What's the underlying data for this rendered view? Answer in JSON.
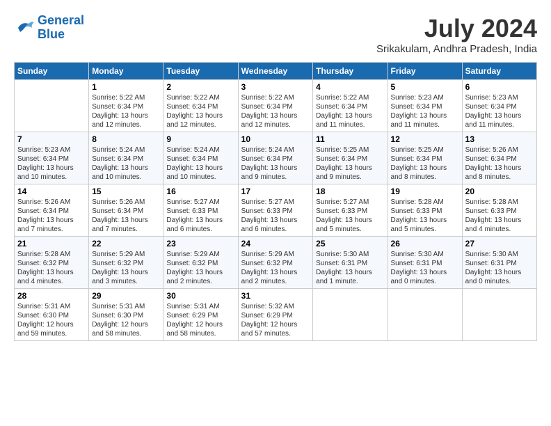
{
  "header": {
    "logo_line1": "General",
    "logo_line2": "Blue",
    "month_year": "July 2024",
    "location": "Srikakulam, Andhra Pradesh, India"
  },
  "weekdays": [
    "Sunday",
    "Monday",
    "Tuesday",
    "Wednesday",
    "Thursday",
    "Friday",
    "Saturday"
  ],
  "weeks": [
    [
      {
        "day": "",
        "info": ""
      },
      {
        "day": "1",
        "info": "Sunrise: 5:22 AM\nSunset: 6:34 PM\nDaylight: 13 hours\nand 12 minutes."
      },
      {
        "day": "2",
        "info": "Sunrise: 5:22 AM\nSunset: 6:34 PM\nDaylight: 13 hours\nand 12 minutes."
      },
      {
        "day": "3",
        "info": "Sunrise: 5:22 AM\nSunset: 6:34 PM\nDaylight: 13 hours\nand 12 minutes."
      },
      {
        "day": "4",
        "info": "Sunrise: 5:22 AM\nSunset: 6:34 PM\nDaylight: 13 hours\nand 11 minutes."
      },
      {
        "day": "5",
        "info": "Sunrise: 5:23 AM\nSunset: 6:34 PM\nDaylight: 13 hours\nand 11 minutes."
      },
      {
        "day": "6",
        "info": "Sunrise: 5:23 AM\nSunset: 6:34 PM\nDaylight: 13 hours\nand 11 minutes."
      }
    ],
    [
      {
        "day": "7",
        "info": "Sunrise: 5:23 AM\nSunset: 6:34 PM\nDaylight: 13 hours\nand 10 minutes."
      },
      {
        "day": "8",
        "info": "Sunrise: 5:24 AM\nSunset: 6:34 PM\nDaylight: 13 hours\nand 10 minutes."
      },
      {
        "day": "9",
        "info": "Sunrise: 5:24 AM\nSunset: 6:34 PM\nDaylight: 13 hours\nand 10 minutes."
      },
      {
        "day": "10",
        "info": "Sunrise: 5:24 AM\nSunset: 6:34 PM\nDaylight: 13 hours\nand 9 minutes."
      },
      {
        "day": "11",
        "info": "Sunrise: 5:25 AM\nSunset: 6:34 PM\nDaylight: 13 hours\nand 9 minutes."
      },
      {
        "day": "12",
        "info": "Sunrise: 5:25 AM\nSunset: 6:34 PM\nDaylight: 13 hours\nand 8 minutes."
      },
      {
        "day": "13",
        "info": "Sunrise: 5:26 AM\nSunset: 6:34 PM\nDaylight: 13 hours\nand 8 minutes."
      }
    ],
    [
      {
        "day": "14",
        "info": "Sunrise: 5:26 AM\nSunset: 6:34 PM\nDaylight: 13 hours\nand 7 minutes."
      },
      {
        "day": "15",
        "info": "Sunrise: 5:26 AM\nSunset: 6:34 PM\nDaylight: 13 hours\nand 7 minutes."
      },
      {
        "day": "16",
        "info": "Sunrise: 5:27 AM\nSunset: 6:33 PM\nDaylight: 13 hours\nand 6 minutes."
      },
      {
        "day": "17",
        "info": "Sunrise: 5:27 AM\nSunset: 6:33 PM\nDaylight: 13 hours\nand 6 minutes."
      },
      {
        "day": "18",
        "info": "Sunrise: 5:27 AM\nSunset: 6:33 PM\nDaylight: 13 hours\nand 5 minutes."
      },
      {
        "day": "19",
        "info": "Sunrise: 5:28 AM\nSunset: 6:33 PM\nDaylight: 13 hours\nand 5 minutes."
      },
      {
        "day": "20",
        "info": "Sunrise: 5:28 AM\nSunset: 6:33 PM\nDaylight: 13 hours\nand 4 minutes."
      }
    ],
    [
      {
        "day": "21",
        "info": "Sunrise: 5:28 AM\nSunset: 6:32 PM\nDaylight: 13 hours\nand 4 minutes."
      },
      {
        "day": "22",
        "info": "Sunrise: 5:29 AM\nSunset: 6:32 PM\nDaylight: 13 hours\nand 3 minutes."
      },
      {
        "day": "23",
        "info": "Sunrise: 5:29 AM\nSunset: 6:32 PM\nDaylight: 13 hours\nand 2 minutes."
      },
      {
        "day": "24",
        "info": "Sunrise: 5:29 AM\nSunset: 6:32 PM\nDaylight: 13 hours\nand 2 minutes."
      },
      {
        "day": "25",
        "info": "Sunrise: 5:30 AM\nSunset: 6:31 PM\nDaylight: 13 hours\nand 1 minute."
      },
      {
        "day": "26",
        "info": "Sunrise: 5:30 AM\nSunset: 6:31 PM\nDaylight: 13 hours\nand 0 minutes."
      },
      {
        "day": "27",
        "info": "Sunrise: 5:30 AM\nSunset: 6:31 PM\nDaylight: 13 hours\nand 0 minutes."
      }
    ],
    [
      {
        "day": "28",
        "info": "Sunrise: 5:31 AM\nSunset: 6:30 PM\nDaylight: 12 hours\nand 59 minutes."
      },
      {
        "day": "29",
        "info": "Sunrise: 5:31 AM\nSunset: 6:30 PM\nDaylight: 12 hours\nand 58 minutes."
      },
      {
        "day": "30",
        "info": "Sunrise: 5:31 AM\nSunset: 6:29 PM\nDaylight: 12 hours\nand 58 minutes."
      },
      {
        "day": "31",
        "info": "Sunrise: 5:32 AM\nSunset: 6:29 PM\nDaylight: 12 hours\nand 57 minutes."
      },
      {
        "day": "",
        "info": ""
      },
      {
        "day": "",
        "info": ""
      },
      {
        "day": "",
        "info": ""
      }
    ]
  ]
}
